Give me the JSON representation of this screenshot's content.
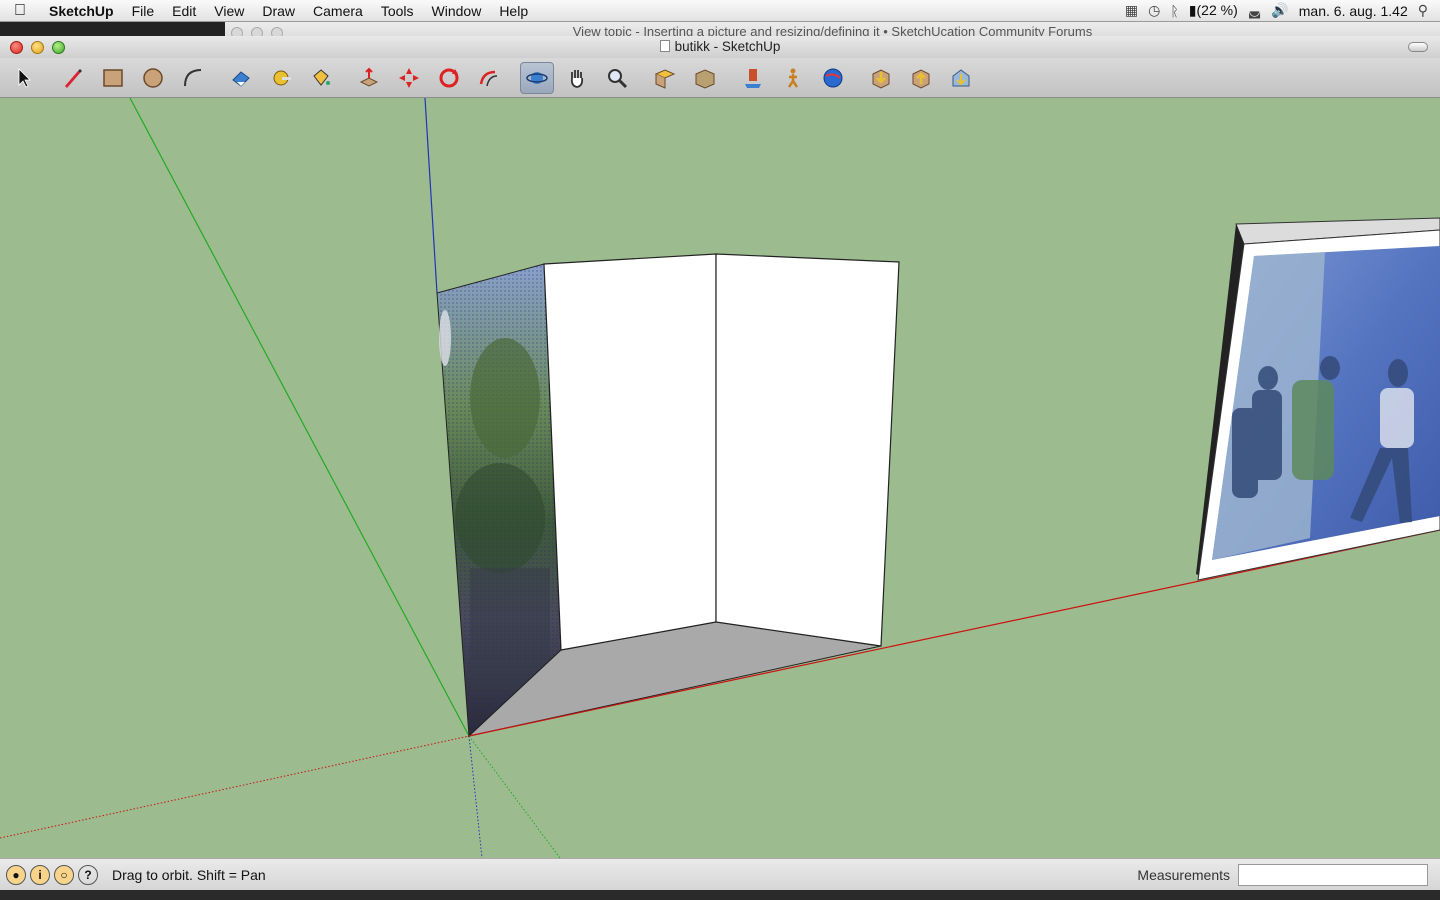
{
  "menubar": {
    "app": "SketchUp",
    "items": [
      "File",
      "Edit",
      "View",
      "Draw",
      "Camera",
      "Tools",
      "Window",
      "Help"
    ],
    "battery": "(22 %)",
    "clock": "man. 6. aug.  1.42"
  },
  "background_window": {
    "title": "View topic - Inserting a picture and resizing/defining it • SketchUcation Community Forums"
  },
  "window": {
    "title": "butikk - SketchUp"
  },
  "toolbar": {
    "tools": [
      "select-tool",
      "pencil-tool",
      "rectangle-tool",
      "circle-tool",
      "arc-tool",
      "eraser-tool",
      "tape-measure-tool",
      "paint-bucket-tool",
      "push-pull-tool",
      "move-tool",
      "rotate-tool",
      "follow-me-tool",
      "orbit-tool",
      "pan-tool",
      "zoom-tool",
      "zoom-extents-tool",
      "previous-view-tool",
      "position-camera-tool",
      "walk-tool",
      "google-earth-tool",
      "get-models-tool",
      "share-model-tool",
      "place-model-tool"
    ],
    "active": "orbit-tool"
  },
  "statusbar": {
    "hint": "Drag to orbit.  Shift = Pan",
    "measurements_label": "Measurements",
    "measurements_value": ""
  },
  "colors": {
    "viewport_bg": "#9cbc8f",
    "axis_red": "#cc1111",
    "axis_green": "#22aa22",
    "axis_blue": "#2233bb"
  }
}
